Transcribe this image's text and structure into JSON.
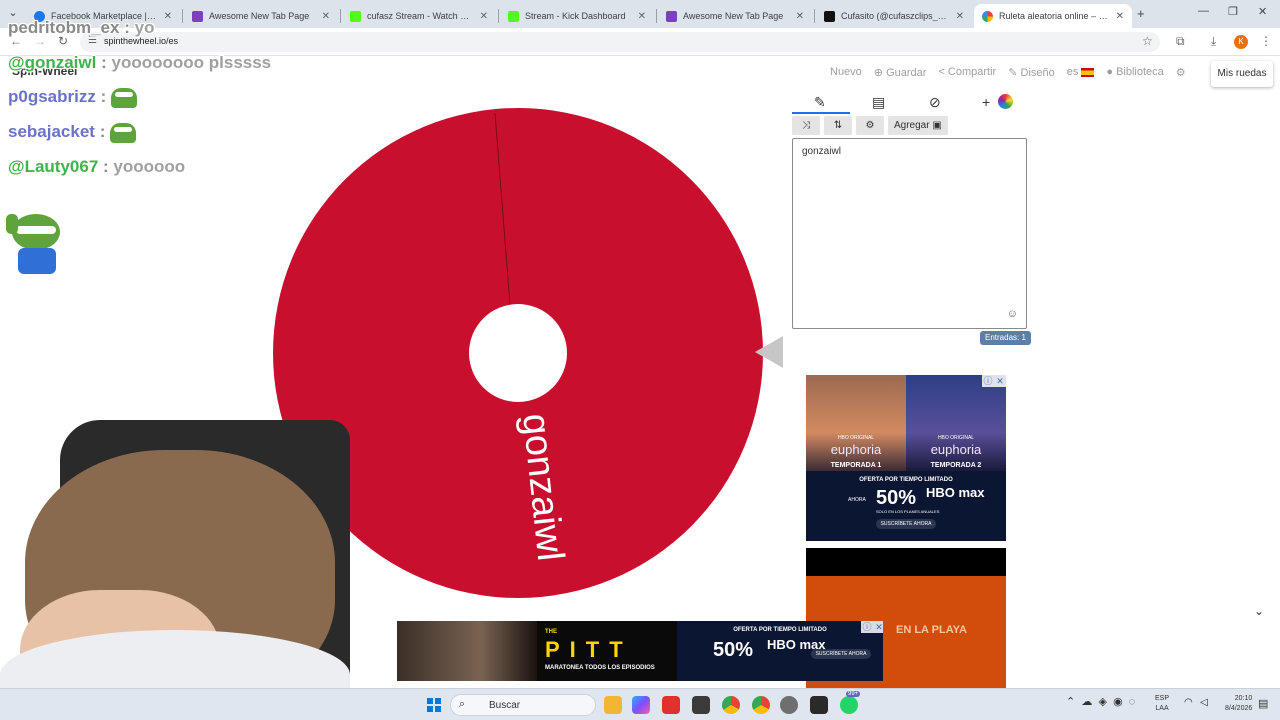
{
  "browser": {
    "tabs": [
      {
        "label": "Facebook Marketplace | Facebook",
        "color": "#1877f2"
      },
      {
        "label": "Awesome New Tab Page",
        "color": "#7b3fbf"
      },
      {
        "label": "cufasz Stream - Watch Live on Kick",
        "color": "#53fc18"
      },
      {
        "label": "Stream - Kick Dashboard",
        "color": "#53fc18"
      },
      {
        "label": "Awesome New Tab Page",
        "color": "#7b3fbf"
      },
      {
        "label": "Cufasito (@cufaszclips_) | TikTok",
        "color": "#111111"
      },
      {
        "label": "Ruleta aleatoria online – ruleta",
        "color": "#ea4335"
      }
    ],
    "url": "spinthewheel.io/es"
  },
  "site": {
    "logo": "Spin-Wheel",
    "nav": {
      "nuevo": "Nuevo",
      "guardar": "Guardar",
      "compartir": "Compartir",
      "diseno": "Diseño",
      "lang": "es",
      "biblioteca": "Biblioteca"
    },
    "mis_ruedas": "Mis ruedas"
  },
  "wheel": {
    "segment_label": "gonzaiwl",
    "segment_color": "#c8102e"
  },
  "panel": {
    "agregar": "Agregar",
    "entries_text": "gonzaiwl",
    "entries_count": "Entradas: 1"
  },
  "chat": [
    {
      "user": "pedritobm_ex",
      "sep": ":",
      "msg": "yo",
      "color": "gray"
    },
    {
      "user": "@gonzaiwl",
      "sep": ":",
      "msg": "yoooooooo plsssss",
      "color": "green"
    },
    {
      "user": "p0gsabrizz",
      "sep": ":",
      "msg": "",
      "color": "blue",
      "emote": true
    },
    {
      "user": "sebajacket",
      "sep": ":",
      "msg": "",
      "color": "blue",
      "emote": true
    },
    {
      "user": "@Lauty067",
      "sep": ":",
      "msg": "yoooooo",
      "color": "green"
    }
  ],
  "ads": {
    "hbo": {
      "title1": "euphoria",
      "season1": "TEMPORADA 1",
      "title2": "euphoria",
      "season2": "TEMPORADA 2",
      "brand": "HBO ORIGINAL",
      "offer": "OFERTA POR TIEMPO LIMITADO",
      "now": "AHORA",
      "pct": "50%",
      "pct_sub": "SOLO EN LOS PLANES ANUALES",
      "hbomax": "HBO max",
      "subscribe": "SUSCRÍBETE AHORA"
    },
    "beach_text": "EN LA PLAYA",
    "pitt": {
      "the": "THE",
      "title": "PITT",
      "sub": "MARATONEA TODOS LOS EPISODIOS",
      "offer": "OFERTA POR TIEMPO LIMITADO",
      "pct": "50%",
      "hbomax": "HBO max",
      "subscribe": "SUSCRÍBETE AHORA"
    }
  },
  "taskbar": {
    "search": "Buscar",
    "lang_top": "ESP",
    "lang_bottom": "LAA",
    "time": "20:10",
    "date": "8/4/2026",
    "chat_badge": "99+"
  }
}
